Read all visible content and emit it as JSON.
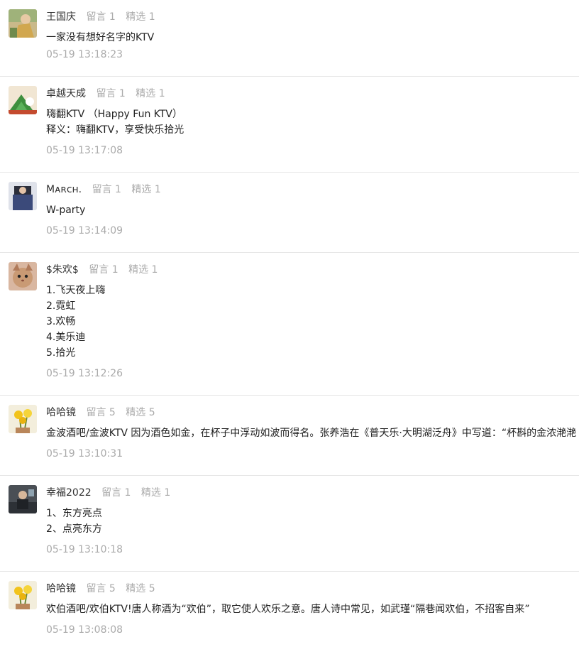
{
  "comments": [
    {
      "author": "王国庆",
      "replies": "留言 1",
      "featured": "精选 1",
      "lines": [
        "一家没有想好名字的KTV"
      ],
      "time": "05-19 13:18:23",
      "avatar": "avatar-photo"
    },
    {
      "author": "卓越天成",
      "replies": "留言 1",
      "featured": "精选 1",
      "lines": [
        "嗨翻KTV （Happy Fun KTV）",
        "释义：嗨翻KTV，享受快乐拾光"
      ],
      "time": "05-19 13:17:08",
      "avatar": "avatar-photo"
    },
    {
      "author": "Mᴀʀᴄʜ.",
      "replies": "留言 1",
      "featured": "精选 1",
      "lines": [
        "W-party"
      ],
      "time": "05-19 13:14:09",
      "avatar": "avatar-photo"
    },
    {
      "author": "$朱欢$",
      "replies": "留言 1",
      "featured": "精选 1",
      "lines": [
        "1.飞天夜上嗨",
        "2.霓虹",
        "3.欢畅",
        "4.美乐迪",
        "5.拾光"
      ],
      "time": "05-19 13:12:26",
      "avatar": "avatar-photo"
    },
    {
      "author": "哈哈镜",
      "replies": "留言 5",
      "featured": "精选 5",
      "lines": [
        "金波酒吧/金波KTV  因为酒色如金，在杯子中浮动如波而得名。张养浩在《普天乐·大明湖泛舟》中写道：“杯斟的金浓滟滟"
      ],
      "time": "05-19 13:10:31",
      "avatar": "avatar-photo"
    },
    {
      "author": "幸福2022",
      "replies": "留言 1",
      "featured": "精选 1",
      "lines": [
        "1、东方亮点",
        "2、点亮东方"
      ],
      "time": "05-19 13:10:18",
      "avatar": "avatar-photo"
    },
    {
      "author": "哈哈镜",
      "replies": "留言 5",
      "featured": "精选 5",
      "lines": [
        "欢伯酒吧/欢伯KTV!唐人称酒为“欢伯”，取它使人欢乐之意。唐人诗中常见，如武瑾“隔巷闻欢伯，不招客自来”"
      ],
      "time": "05-19 13:08:08",
      "avatar": "avatar-photo"
    }
  ]
}
